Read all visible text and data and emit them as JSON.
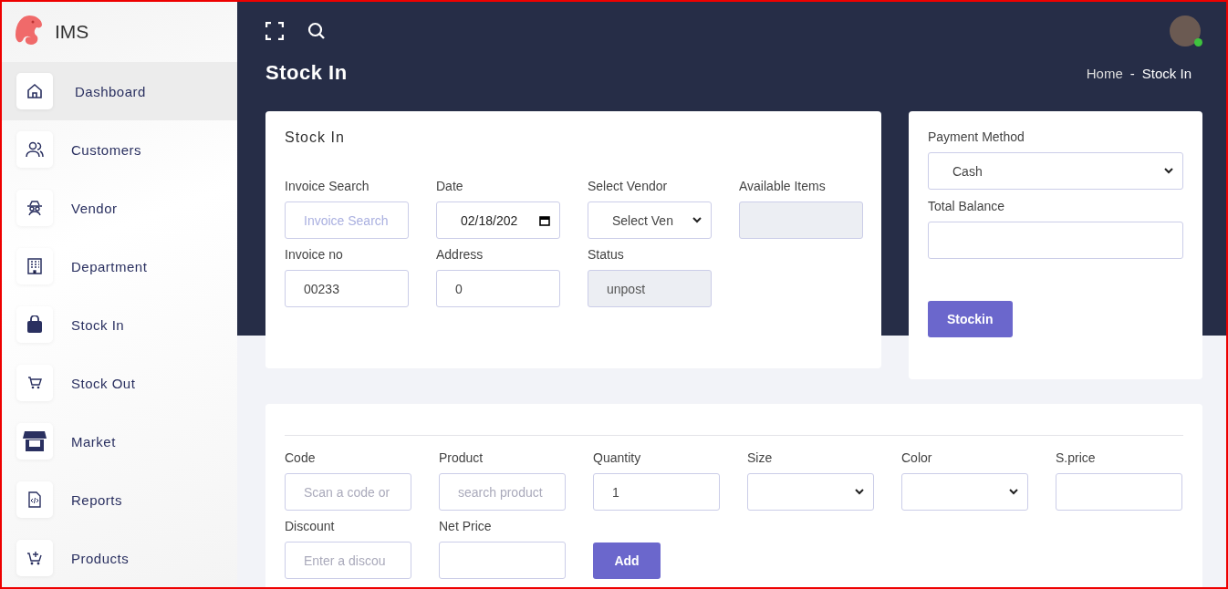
{
  "app": {
    "name": "IMS"
  },
  "sidebar": {
    "items": [
      {
        "label": "Dashboard",
        "selected": true
      },
      {
        "label": "Customers",
        "selected": false
      },
      {
        "label": "Vendor",
        "selected": false
      },
      {
        "label": "Department",
        "selected": false
      },
      {
        "label": "Stock In",
        "selected": false
      },
      {
        "label": "Stock Out",
        "selected": false
      },
      {
        "label": "Market",
        "selected": false
      },
      {
        "label": "Reports",
        "selected": false
      },
      {
        "label": "Products",
        "selected": false
      }
    ]
  },
  "header": {
    "title": "Stock In",
    "breadcrumb": [
      "Home",
      "Stock In"
    ],
    "breadcrumb_separator": "-",
    "user_online": true
  },
  "stock_in_form": {
    "title": "Stock In",
    "fields": [
      {
        "label": "Invoice Search",
        "kind": "text",
        "placeholder": "Invoice Search",
        "disabled": false
      },
      {
        "label": "Date",
        "kind": "date",
        "value": "02/18/202",
        "disabled": false
      },
      {
        "label": "Select Vendor",
        "kind": "select",
        "value": "Select Ven",
        "disabled": false
      },
      {
        "label": "Available Items",
        "kind": "text",
        "disabled": true
      },
      {
        "label": "Invoice no",
        "kind": "text",
        "value": "00233",
        "disabled": false
      },
      {
        "label": "Address",
        "kind": "text",
        "value": "0",
        "disabled": false
      },
      {
        "label": "Status",
        "kind": "text",
        "value": "unpost",
        "disabled": true
      }
    ]
  },
  "payment_panel": {
    "fields": [
      {
        "label": "Payment Method",
        "kind": "select",
        "value": "Cash",
        "disabled": false
      },
      {
        "label": "Total Balance",
        "kind": "text",
        "disabled": false
      }
    ],
    "button": "Stockin"
  },
  "item_form": {
    "fields": [
      {
        "label": "Code",
        "kind": "text",
        "placeholder": "Scan a code or",
        "disabled": false
      },
      {
        "label": "Product",
        "kind": "text",
        "placeholder": "search product",
        "disabled": false
      },
      {
        "label": "Quantity",
        "kind": "text",
        "value": "1",
        "disabled": false
      },
      {
        "label": "Size",
        "kind": "select",
        "disabled": false
      },
      {
        "label": "Color",
        "kind": "select",
        "disabled": false
      },
      {
        "label": "S.price",
        "kind": "text",
        "disabled": false
      },
      {
        "label": "Discount",
        "kind": "text",
        "placeholder": "Enter a discou",
        "disabled": false
      },
      {
        "label": "Net Price",
        "kind": "text",
        "disabled": false
      }
    ],
    "button": "Add"
  }
}
